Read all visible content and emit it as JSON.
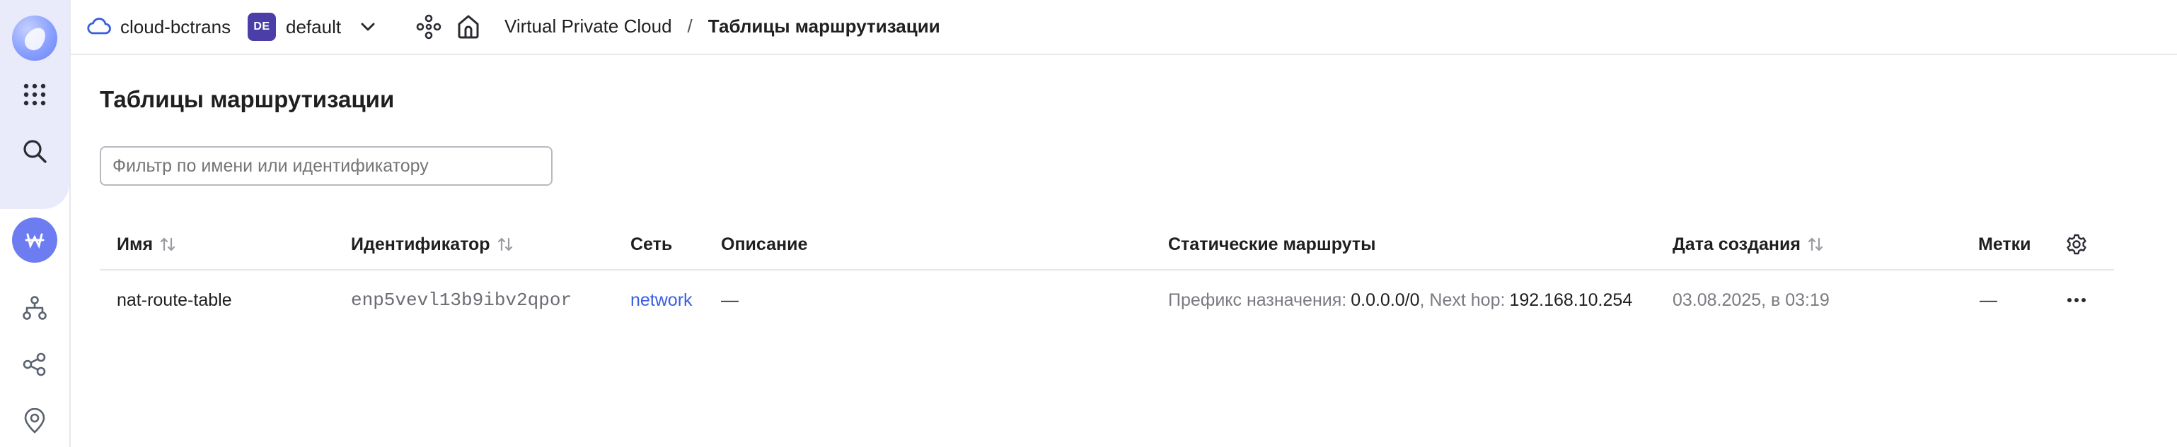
{
  "topbar": {
    "cloud_name": "cloud-bctrans",
    "folder_badge": "DE",
    "folder_name": "default",
    "breadcrumb_service": "Virtual Private Cloud",
    "breadcrumb_separator": "/",
    "breadcrumb_current": "Таблицы маршрутизации"
  },
  "sidebar": {
    "items": [
      {
        "icon": "logo-icon"
      },
      {
        "icon": "apps-grid-icon"
      },
      {
        "icon": "search-icon"
      },
      {
        "icon": "vpc-service-icon"
      },
      {
        "icon": "network-topology-icon"
      },
      {
        "icon": "share-nodes-icon"
      },
      {
        "icon": "location-pin-icon"
      }
    ]
  },
  "page": {
    "title": "Таблицы маршрутизации",
    "filter_placeholder": "Фильтр по имени или идентификатору"
  },
  "table": {
    "columns": {
      "name": "Имя",
      "id": "Идентификатор",
      "network": "Сеть",
      "description": "Описание",
      "static_routes": "Статические маршруты",
      "created": "Дата создания",
      "labels": "Метки"
    },
    "rows": [
      {
        "name": "nat-route-table",
        "id": "enp5vevl13b9ibv2qpor",
        "network": "network",
        "description": "—",
        "route_prefix_label": "Префикс назначения:",
        "route_prefix_value": "0.0.0.0/0",
        "route_nexthop_label": ", Next hop:",
        "route_nexthop_value": "192.168.10.254",
        "created": "03.08.2025, в 03:19",
        "labels": "—"
      }
    ]
  },
  "colors": {
    "accent": "#6d7df1",
    "link": "#3a5ee0",
    "folder_badge": "#4b3ea8",
    "sidebar_bg": "#e9ebfb"
  }
}
